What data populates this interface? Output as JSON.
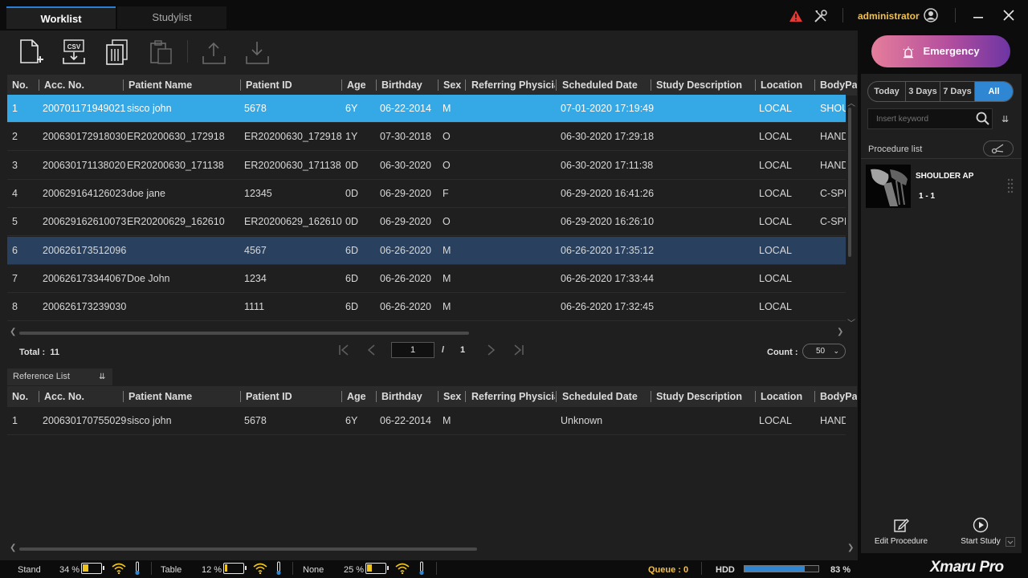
{
  "tabs": [
    {
      "label": "Worklist",
      "active": true
    },
    {
      "label": "Studylist",
      "active": false
    }
  ],
  "header": {
    "user": "administrator",
    "icons": [
      "warning-icon",
      "tools-icon",
      "user-icon",
      "minimize-icon",
      "close-icon"
    ]
  },
  "toolbar": {
    "icons": [
      "new-patient-icon",
      "csv-import-icon",
      "delete-icon",
      "paste-icon",
      "upload-icon",
      "download-icon"
    ],
    "csv_label": "CSV"
  },
  "columns": [
    "No.",
    "Acc. No.",
    "Patient Name",
    "Patient ID",
    "Age",
    "Birthday",
    "Sex",
    "Referring Physician",
    "Scheduled Date",
    "Study Description",
    "Location",
    "BodyPart"
  ],
  "worklist": {
    "rows": [
      {
        "no": "1",
        "acc": "200701171949021",
        "name": "sisco  john",
        "pid": "5678",
        "age": "6Y",
        "birthday": "06-22-2014",
        "sex": "M",
        "ref": "",
        "sched": "07-01-2020 17:19:49",
        "desc": "",
        "loc": "LOCAL",
        "body": "SHOULDER"
      },
      {
        "no": "2",
        "acc": "200630172918030",
        "name": "ER20200630_172918",
        "pid": "ER20200630_172918",
        "age": "1Y",
        "birthday": "07-30-2018",
        "sex": "O",
        "ref": "",
        "sched": "06-30-2020 17:29:18",
        "desc": "",
        "loc": "LOCAL",
        "body": "HAND"
      },
      {
        "no": "3",
        "acc": "200630171138020",
        "name": "ER20200630_171138",
        "pid": "ER20200630_171138",
        "age": "0D",
        "birthday": "06-30-2020",
        "sex": "O",
        "ref": "",
        "sched": "06-30-2020 17:11:38",
        "desc": "",
        "loc": "LOCAL",
        "body": "HAND"
      },
      {
        "no": "4",
        "acc": "200629164126023",
        "name": "doe  jane",
        "pid": "12345",
        "age": "0D",
        "birthday": "06-29-2020",
        "sex": "F",
        "ref": "",
        "sched": "06-29-2020 16:41:26",
        "desc": "",
        "loc": "LOCAL",
        "body": "C-SPINE"
      },
      {
        "no": "5",
        "acc": "200629162610073",
        "name": "ER20200629_162610",
        "pid": "ER20200629_162610",
        "age": "0D",
        "birthday": "06-29-2020",
        "sex": "O",
        "ref": "",
        "sched": "06-29-2020 16:26:10",
        "desc": "",
        "loc": "LOCAL",
        "body": "C-SPINE"
      },
      {
        "no": "6",
        "acc": "200626173512096",
        "name": "",
        "pid": "4567",
        "age": "6D",
        "birthday": "06-26-2020",
        "sex": "M",
        "ref": "",
        "sched": "06-26-2020 17:35:12",
        "desc": "",
        "loc": "LOCAL",
        "body": ""
      },
      {
        "no": "7",
        "acc": "200626173344067",
        "name": "Doe  John",
        "pid": "1234",
        "age": "6D",
        "birthday": "06-26-2020",
        "sex": "M",
        "ref": "",
        "sched": "06-26-2020 17:33:44",
        "desc": "",
        "loc": "LOCAL",
        "body": ""
      },
      {
        "no": "8",
        "acc": "200626173239030",
        "name": "",
        "pid": "1111",
        "age": "6D",
        "birthday": "06-26-2020",
        "sex": "M",
        "ref": "",
        "sched": "06-26-2020 17:32:45",
        "desc": "",
        "loc": "LOCAL",
        "body": ""
      }
    ]
  },
  "pager": {
    "total_label": "Total :",
    "total": "11",
    "page": "1",
    "slash": "/",
    "page_count": "1",
    "count_label": "Count :",
    "count": "50"
  },
  "reference": {
    "tab_label": "Reference List",
    "rows": [
      {
        "no": "1",
        "acc": "200630170755029",
        "name": "sisco  john",
        "pid": "5678",
        "age": "6Y",
        "birthday": "06-22-2014",
        "sex": "M",
        "ref": "",
        "sched": "Unknown",
        "desc": "",
        "loc": "LOCAL",
        "body": "HAND"
      }
    ]
  },
  "right_panel": {
    "emergency_label": "Emergency",
    "ranges": [
      {
        "label": "Today",
        "active": false
      },
      {
        "label": "3 Days",
        "active": false
      },
      {
        "label": "7 Days",
        "active": false
      },
      {
        "label": "All",
        "active": true
      }
    ],
    "search_placeholder": "Insert keyword",
    "procedure_title": "Procedure list",
    "procedure": {
      "name": "SHOULDER AP",
      "seq": "1 - 1"
    },
    "edit_label": "Edit Procedure",
    "start_label": "Start Study"
  },
  "status": {
    "stand_label": "Stand",
    "stand_pct": "34 %",
    "stand_level": 0.34,
    "table_label": "Table",
    "table_pct": "12 %",
    "table_level": 0.12,
    "none_label": "None",
    "none_pct": "25 %",
    "none_level": 0.25,
    "queue": "Queue :  0",
    "hdd_label": "HDD",
    "hdd_pct": "83  %",
    "hdd_level": 0.83,
    "brand": "Xmaru Pro"
  },
  "colors": {
    "selected_row": "#35a8e6",
    "hover_row": "#29415e",
    "accent": "#2f86d3",
    "warning": "#e53935",
    "user_text": "#f2c14e",
    "battery": "#f0c419"
  }
}
